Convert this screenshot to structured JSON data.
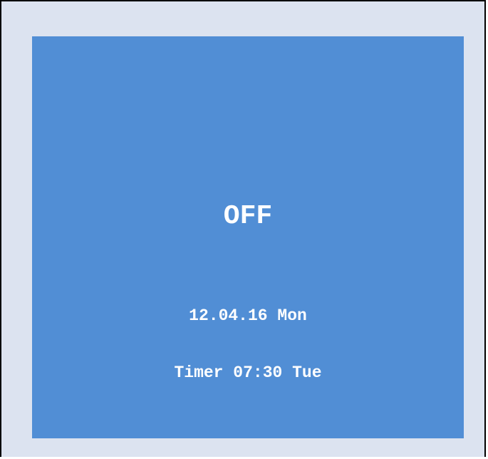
{
  "display": {
    "state": "OFF",
    "date_line": "12.04.16 Mon",
    "timer_line": "Timer 07:30 Tue"
  },
  "colors": {
    "screen_background": "#518ed5",
    "outer_background": "#dce3f0",
    "text": "#ffffff"
  }
}
